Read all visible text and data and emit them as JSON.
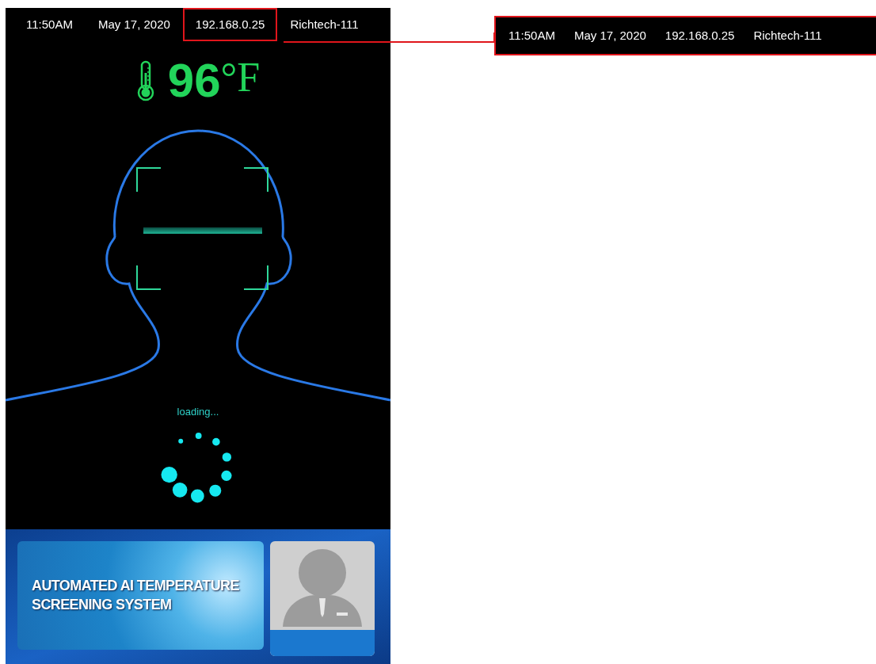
{
  "status_bar": {
    "items": [
      {
        "text": "11:50AM",
        "highlighted": false
      },
      {
        "text": "May 17, 2020",
        "highlighted": false
      },
      {
        "text": "192.168.0.25",
        "highlighted": true
      },
      {
        "text": "Richtech-111",
        "highlighted": false
      }
    ]
  },
  "temperature": {
    "value": "96",
    "unit": "°F"
  },
  "scan": {
    "status": "loading..."
  },
  "banner": {
    "title": "AUTOMATED AI TEMPERATURE SCREENING SYSTEM"
  },
  "callout": {
    "items": [
      "11:50AM",
      "May 17, 2020",
      "192.168.0.25",
      "Richtech-111"
    ]
  }
}
